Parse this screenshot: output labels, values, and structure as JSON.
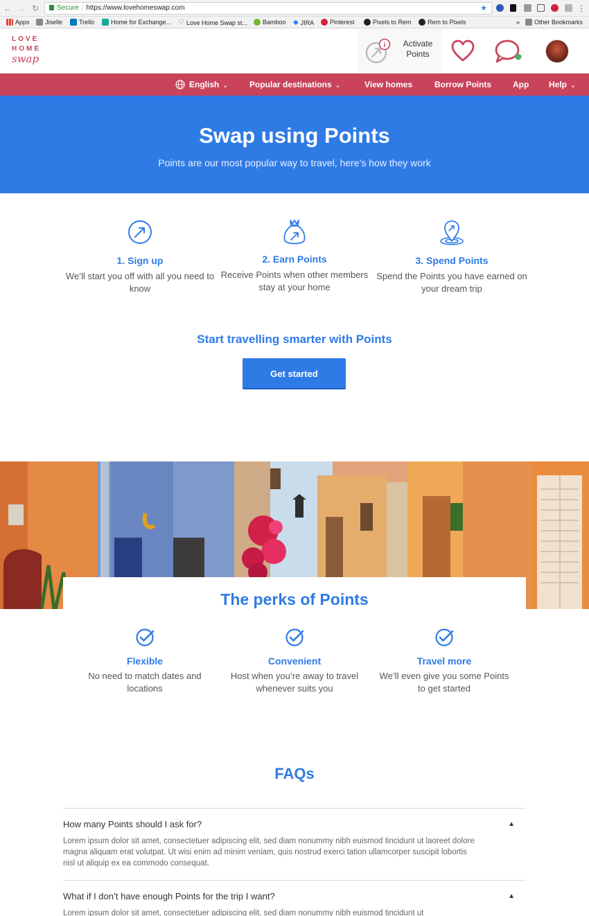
{
  "browser": {
    "secure_label": "Secure",
    "url": "https://www.lovehomeswap.com",
    "bookmarks": [
      "Apps",
      "Jiselle",
      "Trello",
      "Home for Exchange...",
      "Love Home Swap st...",
      "Bamboo",
      "JIRA",
      "Pinterest",
      "Pixels to Rem",
      "Rem to Pixels"
    ],
    "overflow": "»",
    "other_bookmarks": "Other Bookmarks"
  },
  "header": {
    "logo_love": "LOVE",
    "logo_home": "HOME",
    "logo_swap": "swap",
    "activate_label": "Activate Points",
    "icons": [
      "activate-points-icon",
      "heart-icon",
      "chat-icon",
      "avatar"
    ],
    "accent": "#c9445b"
  },
  "nav": {
    "items": [
      {
        "label": "English"
      },
      {
        "label": "Popular destinations"
      },
      {
        "label": "View homes"
      },
      {
        "label": "Borrow Points"
      },
      {
        "label": "App"
      },
      {
        "label": "Help"
      }
    ]
  },
  "hero": {
    "title": "Swap using Points",
    "subtitle": "Points are our most popular way to travel, here’s how they work",
    "color": "#2f7be6"
  },
  "steps": [
    {
      "title": "1. Sign up",
      "text": "We’ll start you off with all you need to know",
      "icon": "compass-arrow-icon"
    },
    {
      "title": "2. Earn Points",
      "text": "Receive Points when other members stay at your home",
      "icon": "money-bag-icon"
    },
    {
      "title": "3. Spend Points",
      "text": "Spend the Points you have earned on your dream trip",
      "icon": "location-pin-icon"
    }
  ],
  "cta": {
    "line": "Start travelling smarter with Points",
    "button": "Get started"
  },
  "perks": {
    "title": "The perks of Points",
    "items": [
      {
        "title": "Flexible",
        "text": "No need to match dates and locations"
      },
      {
        "title": "Convenient",
        "text": "Host when you’re away to travel whenever suits you"
      },
      {
        "title": "Travel more",
        "text": "We’ll even give you some Points to get started"
      }
    ]
  },
  "faqs": {
    "title": "FAQs",
    "items": [
      {
        "question": "How many Points should I ask for?",
        "answer": "Lorem ipsum dolor sit amet, consectetuer adipiscing elit, sed diam nonummy nibh euismod tincidunt ut laoreet dolore magna aliquam erat volutpat. Ut wisi enim ad minim veniam, quis nostrud exerci tation ullamcorper suscipit lobortis nisl ut aliquip ex ea commodo consequat."
      },
      {
        "question": "What if I don’t have enough Points for the trip I want?",
        "answer": "Lorem ipsum dolor sit amet, consectetuer adipiscing elit, sed diam nonummy nibh euismod tincidunt ut"
      }
    ]
  }
}
